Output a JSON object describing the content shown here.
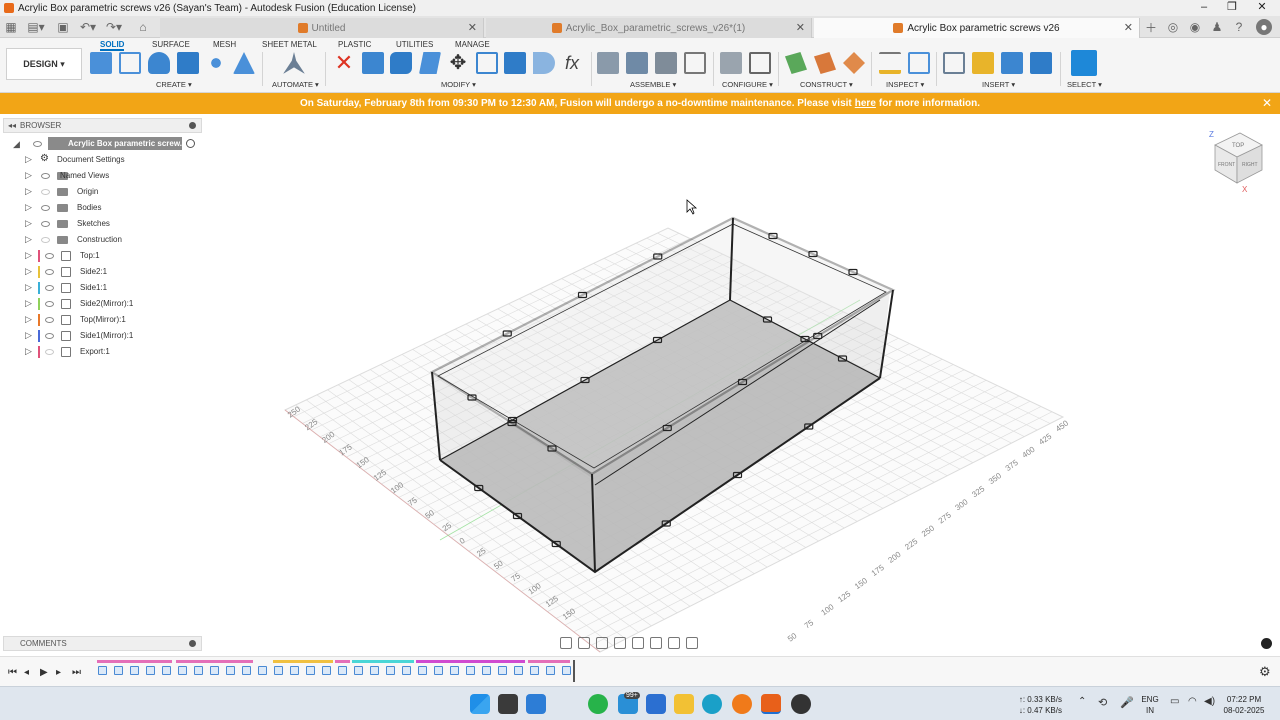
{
  "window": {
    "title": "Acrylic Box parametric screws v26 (Sayan's Team) - Autodesk Fusion (Education License)"
  },
  "tabs": [
    {
      "label": "Untitled",
      "active": false
    },
    {
      "label": "Acrylic_Box_parametric_screws_v26*(1)",
      "active": false
    },
    {
      "label": "Acrylic Box parametric screws v26",
      "active": true
    }
  ],
  "workspace": {
    "label": "DESIGN ▾"
  },
  "ribbon_tabs": [
    "SOLID",
    "SURFACE",
    "MESH",
    "SHEET METAL",
    "PLASTIC",
    "UTILITIES",
    "MANAGE"
  ],
  "ribbon_groups": [
    "CREATE ▾",
    "AUTOMATE ▾",
    "MODIFY ▾",
    "ASSEMBLE ▾",
    "CONFIGURE ▾",
    "CONSTRUCT ▾",
    "INSPECT ▾",
    "INSERT ▾",
    "SELECT ▾"
  ],
  "banner": {
    "text_before": "On Saturday, February 8th from 09:30 PM to 12:30 AM, Fusion will undergo a no-downtime maintenance. Please visit",
    "link": "here",
    "text_after": "for more information."
  },
  "browser": {
    "title": "BROWSER",
    "root": "Acrylic Box parametric screw...",
    "items": [
      {
        "label": "Document Settings",
        "icon": "gear-icon"
      },
      {
        "label": "Named Views",
        "icon": "folder-icon"
      },
      {
        "label": "Origin",
        "icon": "folder-icon"
      },
      {
        "label": "Bodies",
        "icon": "folder-icon"
      },
      {
        "label": "Sketches",
        "icon": "folder-icon"
      },
      {
        "label": "Construction",
        "icon": "folder-icon"
      },
      {
        "label": "Top:1",
        "icon": "component-icon",
        "color": "#e0527a"
      },
      {
        "label": "Side2:1",
        "icon": "component-icon",
        "color": "#e8c23a"
      },
      {
        "label": "Side1:1",
        "icon": "component-icon",
        "color": "#3ab0d8"
      },
      {
        "label": "Side2(Mirror):1",
        "icon": "component-icon",
        "color": "#8fd15a"
      },
      {
        "label": "Top(Mirror):1",
        "icon": "component-icon",
        "color": "#e8782a"
      },
      {
        "label": "Side1(Mirror):1",
        "icon": "component-icon",
        "color": "#4a6ad8"
      },
      {
        "label": "Export:1",
        "icon": "component-icon",
        "color": "#e0527a"
      }
    ]
  },
  "comments": {
    "title": "COMMENTS"
  },
  "viewcube": {
    "top": "TOP",
    "front": "FRONT",
    "right": "RIGHT",
    "z": "Z",
    "x": "X"
  },
  "grid_labels": {
    "right": [
      "450",
      "425",
      "400",
      "375",
      "350",
      "325",
      "300",
      "275",
      "250",
      "225",
      "200",
      "175",
      "150",
      "125",
      "100",
      "75",
      "50"
    ],
    "left": [
      "250",
      "225",
      "200",
      "175",
      "150",
      "125",
      "100",
      "75",
      "50",
      "25",
      "0",
      "25",
      "50",
      "75",
      "100",
      "125",
      "150"
    ]
  },
  "taskbar": {
    "net_up": "↑: 0.33 KB/s",
    "net_down": "↓: 0.47 KB/s",
    "lang": "ENG",
    "region": "IN",
    "time": "07:22 PM",
    "date": "08-02-2025",
    "badge": "99+"
  },
  "colors": {
    "accent": "#0070c0",
    "banner": "#f2a516"
  }
}
